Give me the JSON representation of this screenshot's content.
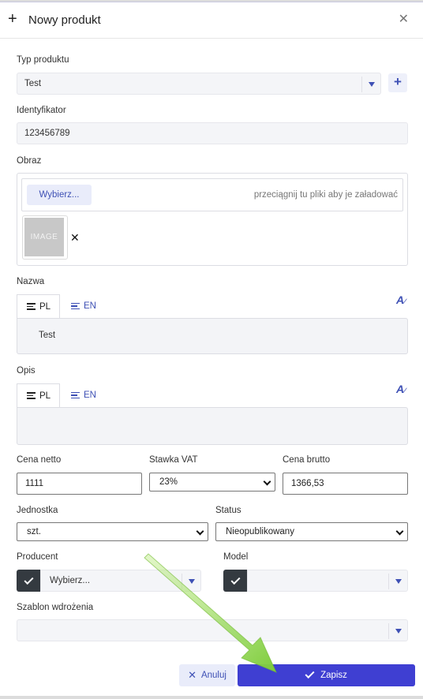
{
  "modal": {
    "title": "Nowy produkt",
    "product_type": {
      "label": "Typ produktu",
      "value": "Test"
    },
    "identifier": {
      "label": "Identyfikator",
      "value": "123456789"
    },
    "image": {
      "label": "Obraz",
      "choose_label": "Wybierz...",
      "drop_hint": "przeciągnij tu pliki aby je załadować",
      "thumbnail_text": "IMAGE",
      "remove_glyph": "✕"
    },
    "name": {
      "label": "Nazwa",
      "tabs": [
        {
          "label": "PL"
        },
        {
          "label": "EN"
        }
      ],
      "value": "Test"
    },
    "description": {
      "label": "Opis",
      "tabs": [
        {
          "label": "PL"
        },
        {
          "label": "EN"
        }
      ],
      "value": ""
    },
    "net_price": {
      "label": "Cena netto",
      "value": "1111"
    },
    "vat": {
      "label": "Stawka VAT",
      "value": "23%"
    },
    "gross_price": {
      "label": "Cena brutto",
      "value": "1366,53"
    },
    "unit": {
      "label": "Jednostka",
      "value": "szt."
    },
    "status": {
      "label": "Status",
      "value": "Nieopublikowany"
    },
    "producer": {
      "label": "Producent",
      "value": "Wybierz..."
    },
    "model": {
      "label": "Model",
      "value": ""
    },
    "template": {
      "label": "Szablon wdrożenia",
      "value": ""
    },
    "buttons": {
      "cancel": "Anuluj",
      "save": "Zapisz"
    }
  },
  "colors": {
    "accent": "#3f51b5",
    "primary_button": "#3f3fd2",
    "annotation_arrow": "#7dcc3a"
  },
  "icons": [
    "plus-icon",
    "close-icon",
    "caret-down-icon",
    "translate-icon",
    "text-lines-icon",
    "check-icon",
    "chevron-down-icon"
  ]
}
